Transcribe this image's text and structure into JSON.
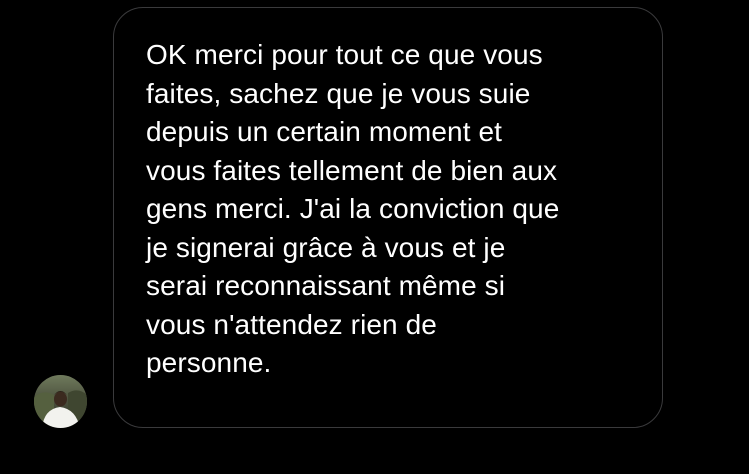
{
  "conversation": {
    "message": {
      "lines": [
        "OK merci pour tout ce que vous",
        "faites, sachez que je vous suie",
        "depuis un certain moment et",
        "vous faites tellement de bien aux",
        "gens merci. J'ai la conviction que",
        "je signerai grâce à vous et je",
        "serai reconnaissant même si",
        "vous n'attendez rien de",
        "personne."
      ]
    },
    "sender": {
      "avatar_icon": "person-photo"
    }
  },
  "colors": {
    "background": "#000000",
    "bubble_border": "#3a3a3c",
    "text": "#ffffff"
  }
}
